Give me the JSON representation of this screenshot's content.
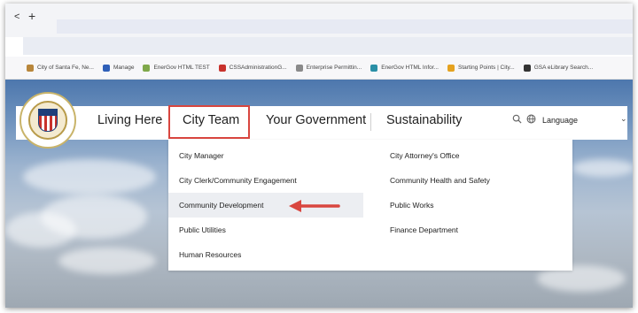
{
  "browser": {
    "back_glyph": "<",
    "new_tab_glyph": "+",
    "bookmarks": [
      {
        "label": "City of Santa Fe, Ne...",
        "color": "#b8863b"
      },
      {
        "label": "Manage",
        "color": "#2f5fb8"
      },
      {
        "label": "EnerGov HTML TEST",
        "color": "#7fa84a"
      },
      {
        "label": "CSSAdministrationG...",
        "color": "#c8322c"
      },
      {
        "label": "Enterprise Permittin...",
        "color": "#8a8a8a"
      },
      {
        "label": "EnerGov HTML Infor...",
        "color": "#2a8fa6"
      },
      {
        "label": "Starting Points | City...",
        "color": "#e5a21f"
      },
      {
        "label": "GSA eLibrary Search...",
        "color": "#333333"
      }
    ]
  },
  "site": {
    "logo_icon": "city-seal-icon",
    "nav": {
      "living_here": "Living Here",
      "city_team": "City Team",
      "your_government": "Your Government",
      "sustainability": "Sustainability",
      "search_icon": "search-icon",
      "globe_icon": "globe-icon",
      "language": "Language",
      "language_caret": "⌄"
    },
    "accent_color": "#d9463f",
    "dropdown": {
      "left_column": [
        "City Manager",
        "City Clerk/Community Engagement",
        "Community Development",
        "Public Utilities",
        "Human Resources"
      ],
      "right_column": [
        "City Attorney's Office",
        "Community Health and Safety",
        "Public Works",
        "Finance Department"
      ],
      "highlighted": "Community Development",
      "annotation": "red-arrow-icon"
    }
  }
}
